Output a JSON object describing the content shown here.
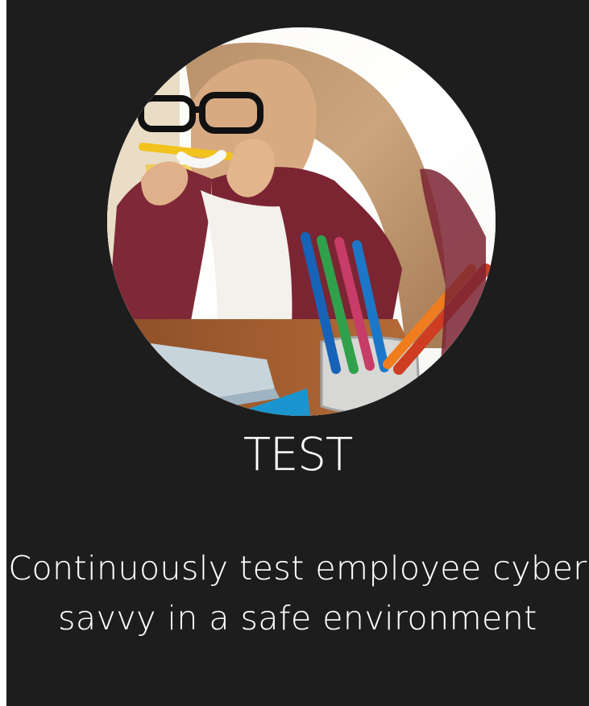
{
  "feature": {
    "image": {
      "alt": "Woman at a desk biting a pencil with colored pencils and a laptop",
      "icon": "profile-photo"
    },
    "title": "TEST",
    "description_lines": [
      "Continuously test employee cyber",
      "savvy in a safe environment"
    ]
  },
  "colors": {
    "card_background": "#1d1d1d",
    "text": "#ffffff"
  }
}
